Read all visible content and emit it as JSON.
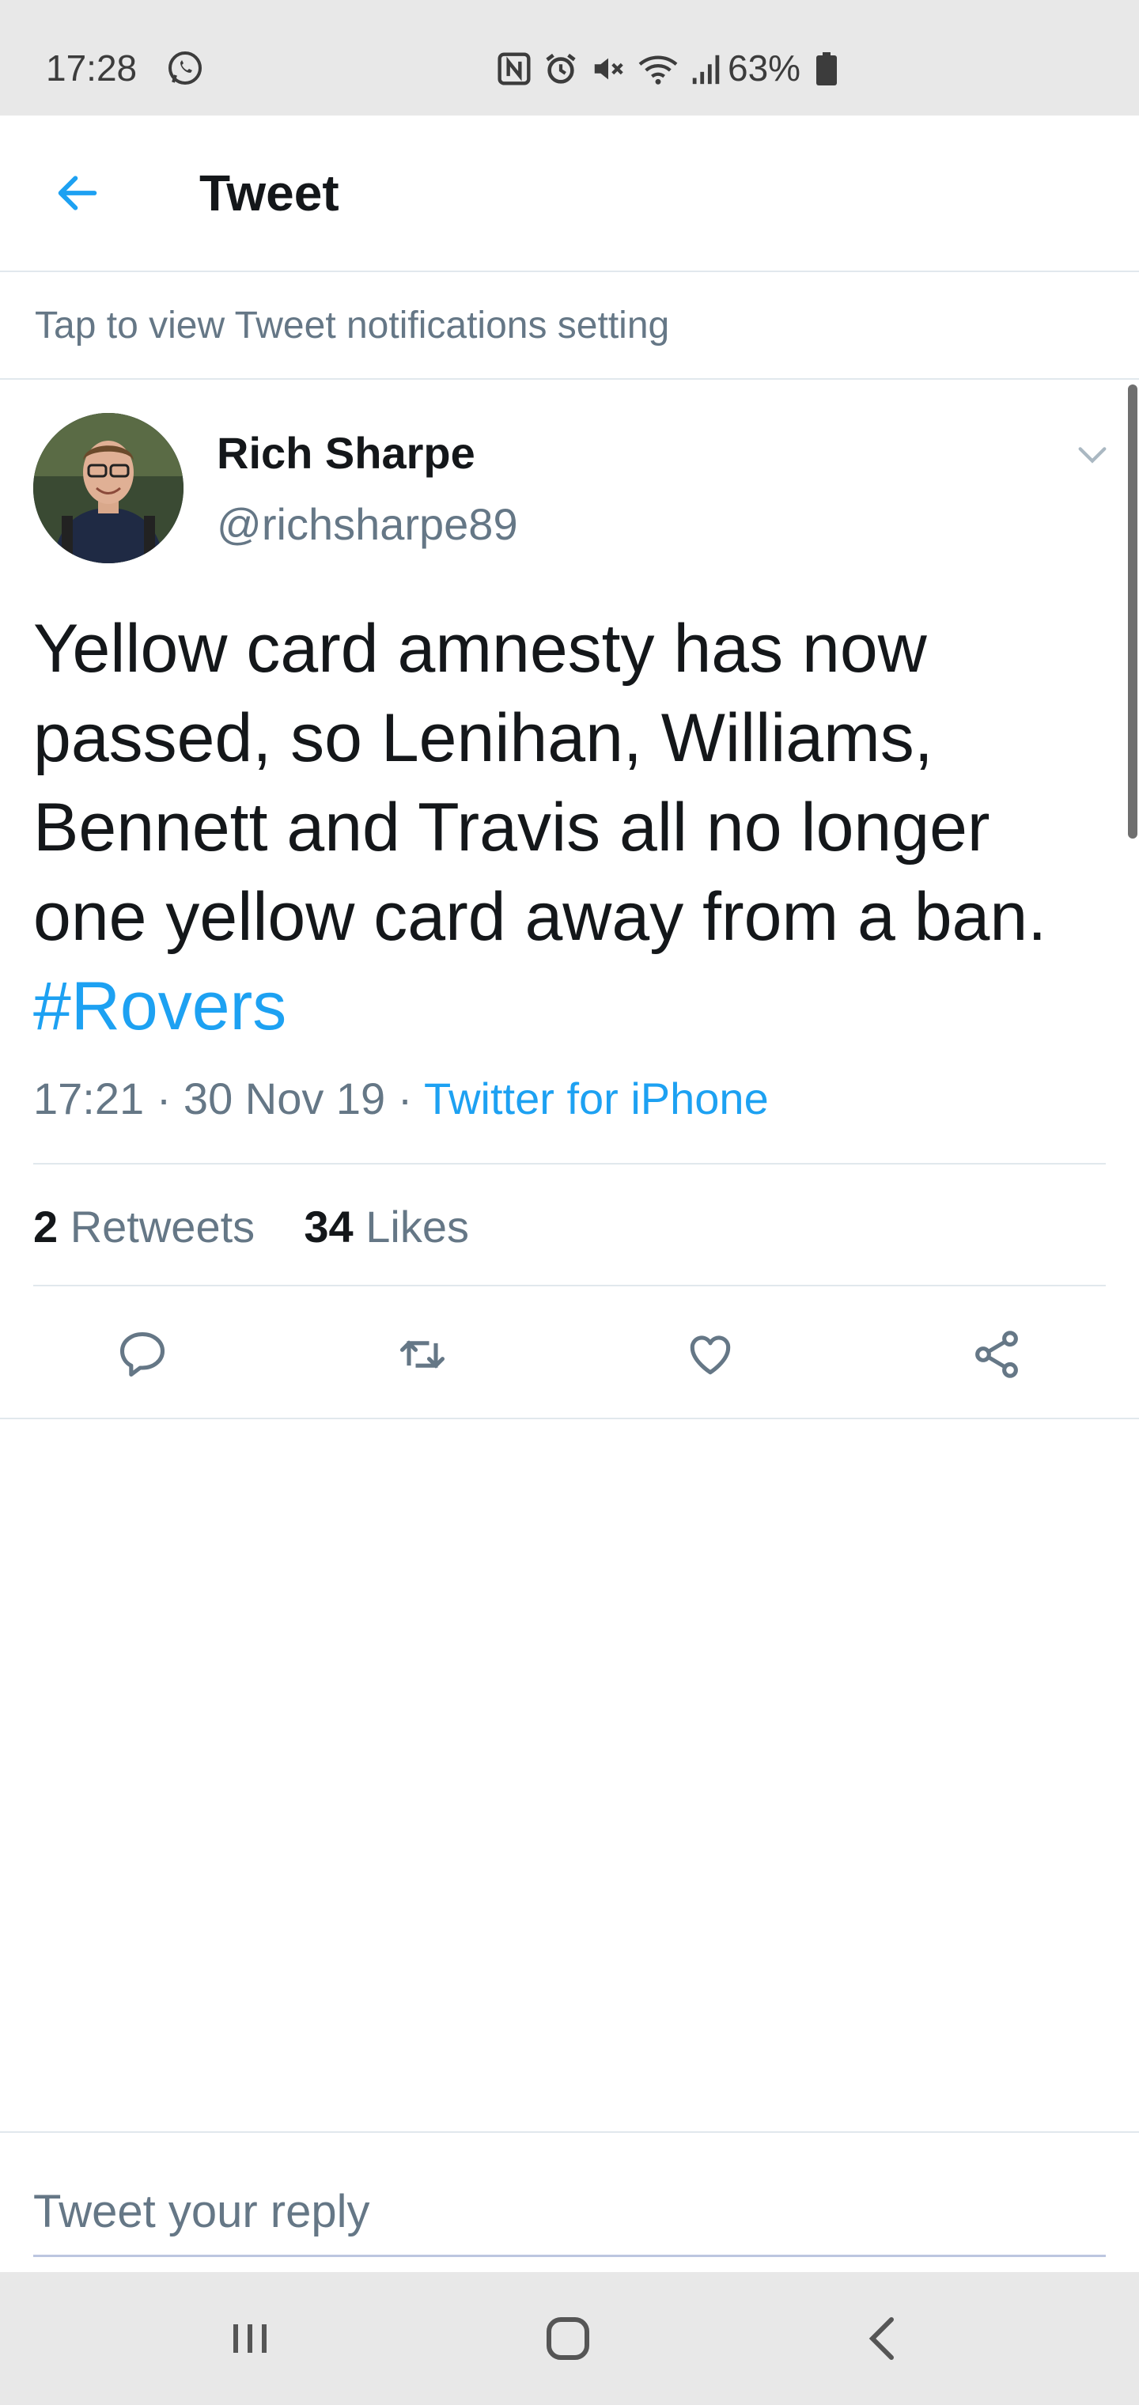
{
  "status_bar": {
    "time": "17:28",
    "battery_percent": "63%",
    "icons": [
      "whatsapp-icon",
      "nfc-icon",
      "alarm-icon",
      "mute-icon",
      "wifi-icon",
      "signal-icon",
      "battery-icon"
    ]
  },
  "header": {
    "title": "Tweet"
  },
  "notification_banner": {
    "text": "Tap to view Tweet notifications setting"
  },
  "tweet": {
    "author_name": "Rich Sharpe",
    "author_handle": "@richsharpe89",
    "text": "Yellow card amnesty has now passed, so Lenihan, Williams, Bennett and Travis all no longer one yellow card away from a ban.",
    "hashtag": "#Rovers",
    "time": "17:21",
    "date": "30 Nov 19",
    "separator": "·",
    "source": "Twitter for iPhone",
    "retweets_count": "2",
    "retweets_label": "Retweets",
    "likes_count": "34",
    "likes_label": "Likes"
  },
  "actions": [
    "reply-icon",
    "retweet-icon",
    "like-icon",
    "share-icon"
  ],
  "reply": {
    "placeholder": "Tweet your reply"
  },
  "colors": {
    "accent": "#1da1f2",
    "secondary_text": "#657786",
    "divider": "#e1e8ed",
    "system_bar": "#e8e8e8"
  }
}
